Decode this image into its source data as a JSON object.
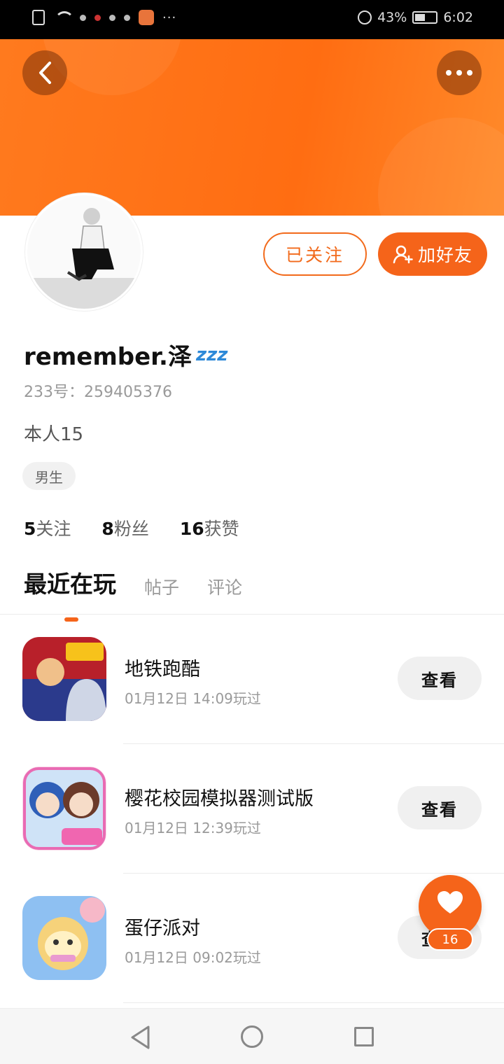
{
  "status_bar": {
    "battery": "43%",
    "time": "6:02",
    "more": "···"
  },
  "header": {
    "back_icon": "chevron-left-icon",
    "more_icon": "more-dots-icon"
  },
  "profile": {
    "followed_label": "已关注",
    "add_friend_label": "加好友",
    "username": "remember.泽",
    "status_emoji": "zzz",
    "uid": "233号：259405376",
    "bio": "本人15",
    "tag": "男生",
    "stats": [
      {
        "count": "5",
        "label": "关注"
      },
      {
        "count": "8",
        "label": "粉丝"
      },
      {
        "count": "16",
        "label": "获赞"
      }
    ]
  },
  "tabs": [
    {
      "label": "最近在玩",
      "active": true
    },
    {
      "label": "帖子",
      "active": false
    },
    {
      "label": "评论",
      "active": false
    }
  ],
  "games": [
    {
      "name": "地铁跑酷",
      "time": "01月12日 14:09玩过",
      "button": "查看",
      "icon_colors": [
        "#c9232a",
        "#2b3a8c"
      ]
    },
    {
      "name": "樱花校园模拟器测试版",
      "time": "01月12日 12:39玩过",
      "button": "查看",
      "icon_colors": [
        "#3a6fd1",
        "#f2a6c8"
      ]
    },
    {
      "name": "蛋仔派对",
      "time": "01月12日 09:02玩过",
      "button": "查看",
      "icon_colors": [
        "#7fb6f0",
        "#f6d27a"
      ]
    }
  ],
  "like_fab": {
    "icon": "heart-icon",
    "count": "16"
  },
  "colors": {
    "accent": "#f5641a",
    "banner": "#ff7a1e"
  }
}
